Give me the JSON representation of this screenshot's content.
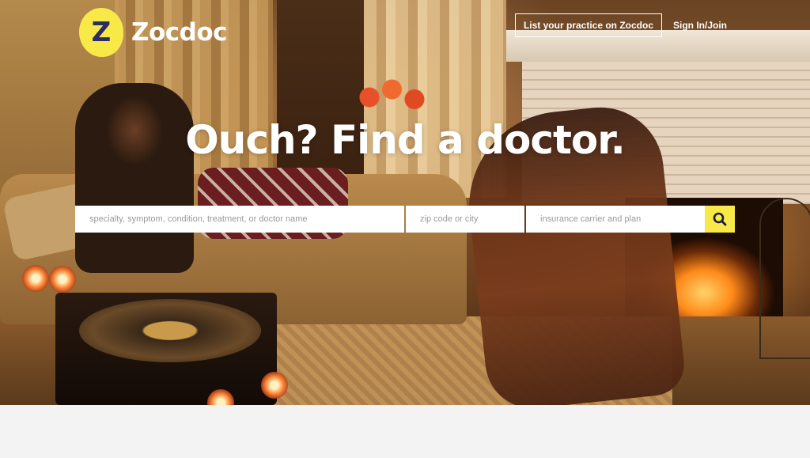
{
  "brand": {
    "name": "Zocdoc",
    "logo_glyph": "Z",
    "accent": "#f8e948",
    "logo_ink": "#2a2e63"
  },
  "header": {
    "list_practice_label": "List your practice on Zocdoc",
    "signin_label": "Sign In/Join"
  },
  "hero": {
    "headline": "Ouch? Find a doctor."
  },
  "search": {
    "specialty_placeholder": "specialty, symptom, condition, treatment, or doctor name",
    "zip_placeholder": "zip code or city",
    "insurance_placeholder": "insurance carrier and plan",
    "button_icon": "search-icon"
  }
}
